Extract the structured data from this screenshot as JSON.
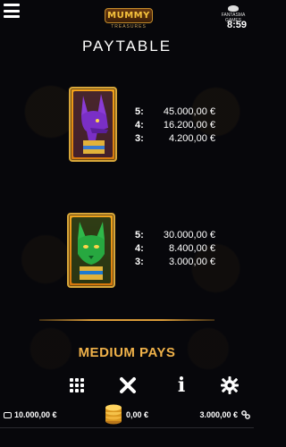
{
  "header": {
    "logo_main": "MUMMY",
    "logo_sub": "TREASURES",
    "brand": "FANTASMA GAMES",
    "clock": "8:59"
  },
  "page_title": "PAYTABLE",
  "symbols": [
    {
      "icon": "anubis-symbol-icon",
      "payouts": [
        {
          "count": "5:",
          "amount": "45.000,00 €"
        },
        {
          "count": "4:",
          "amount": "16.200,00 €"
        },
        {
          "count": "3:",
          "amount": "4.200,00 €"
        }
      ]
    },
    {
      "icon": "cat-goddess-symbol-icon",
      "payouts": [
        {
          "count": "5:",
          "amount": "30.000,00 €"
        },
        {
          "count": "4:",
          "amount": "8.400,00 €"
        },
        {
          "count": "3:",
          "amount": "3.000,00 €"
        }
      ]
    }
  ],
  "section_title": "MEDIUM PAYS",
  "controls": [
    "grid-menu-icon",
    "close-icon",
    "info-icon",
    "gear-icon"
  ],
  "status": {
    "balance": "10.000,00 €",
    "bet": "0,00 €",
    "win": "3.000,00 €"
  },
  "colors": {
    "accent": "#f0b24a",
    "background": "#07070b",
    "frame": "#d7a63a"
  }
}
